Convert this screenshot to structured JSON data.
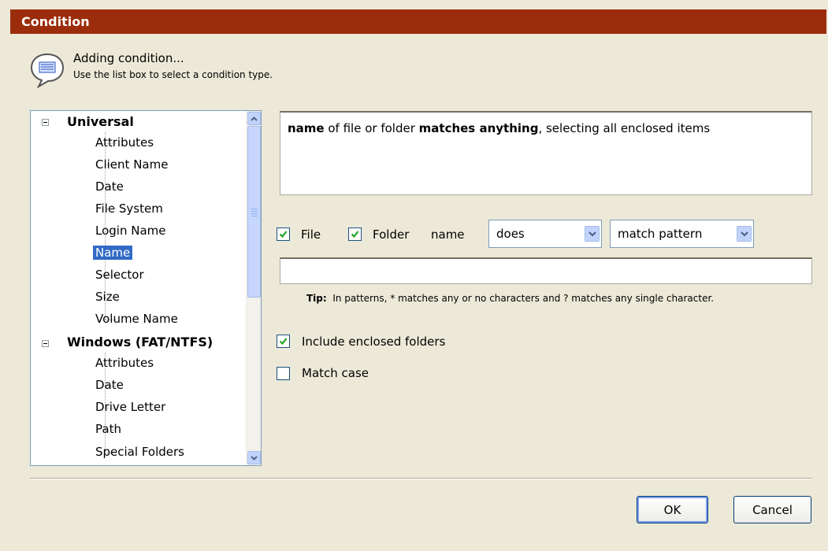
{
  "dialog": {
    "title": "Condition"
  },
  "header": {
    "title": "Adding condition...",
    "subtitle": "Use the list box to select a condition type."
  },
  "tree": {
    "groups": [
      {
        "label": "Universal",
        "items": [
          "Attributes",
          "Client Name",
          "Date",
          "File System",
          "Login Name",
          "Name",
          "Selector",
          "Size",
          "Volume Name"
        ]
      },
      {
        "label": "Windows (FAT/NTFS)",
        "items": [
          "Attributes",
          "Date",
          "Drive Letter",
          "Path",
          "Special Folders"
        ]
      }
    ],
    "selected": "Name"
  },
  "description": {
    "part1_bold": "name",
    "part2": " of file or folder ",
    "part3_bold": "matches anything",
    "part4": ", selecting all enclosed items"
  },
  "criteria": {
    "file_label": "File",
    "file_checked": true,
    "folder_label": "Folder",
    "folder_checked": true,
    "name_label": "name",
    "does_value": "does",
    "match_value": "match pattern",
    "pattern_value": ""
  },
  "tip": {
    "label": "Tip:",
    "text": "In patterns, * matches any or no characters and ? matches any single character."
  },
  "options": {
    "include_enclosed_label": "Include enclosed folders",
    "include_enclosed_checked": true,
    "match_case_label": "Match case",
    "match_case_checked": false
  },
  "buttons": {
    "ok": "OK",
    "cancel": "Cancel"
  },
  "colors": {
    "title_bar": "#9b2d0c",
    "selection": "#316ac5",
    "dialog_bg": "#ece9d8"
  }
}
